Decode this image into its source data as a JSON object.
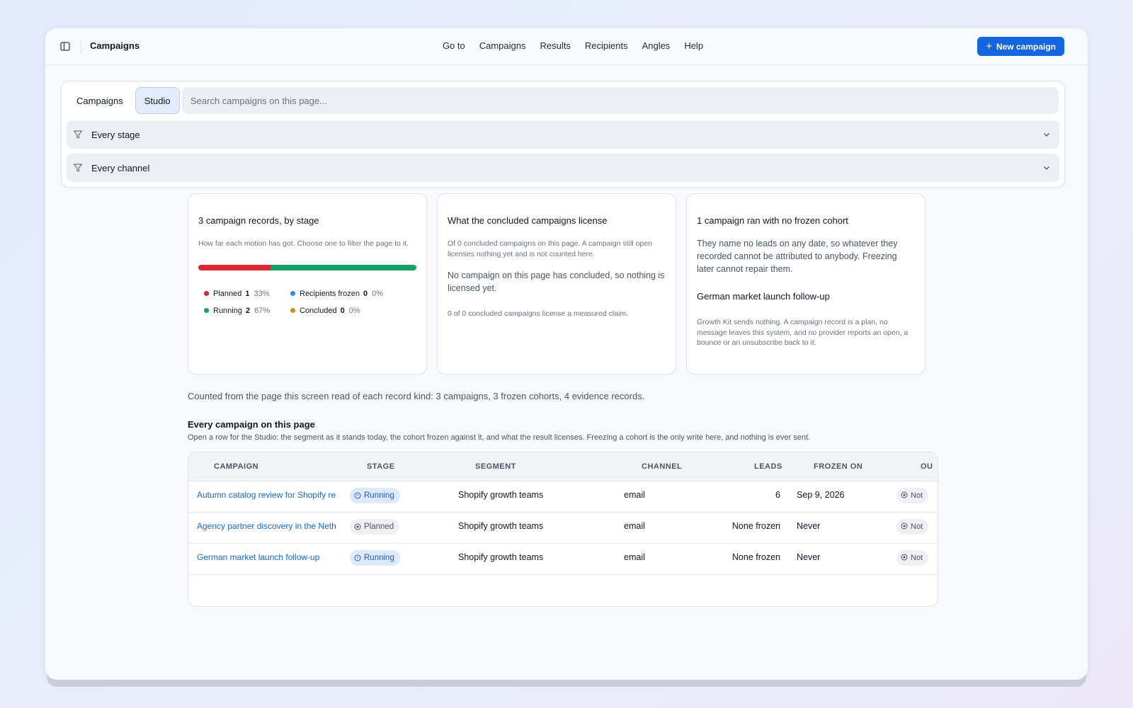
{
  "app": {
    "title": "Campaigns"
  },
  "nav": {
    "items": [
      "Go to",
      "Campaigns",
      "Results",
      "Recipients",
      "Angles",
      "Help"
    ]
  },
  "new_campaign": {
    "label": "New campaign"
  },
  "filters": {
    "tabs": [
      {
        "label": "Campaigns"
      },
      {
        "label": "Studio",
        "active": true
      }
    ],
    "search_placeholder": "Search campaigns on this page...",
    "stage_select": "Every stage",
    "channel_select": "Every channel"
  },
  "cards": {
    "stages": {
      "title": "3 campaign records, by stage",
      "subtitle": "How far each motion has got. Choose one to filter the page to it.",
      "bar": {
        "planned_fraction": 0.33,
        "running_fraction": 0.67
      },
      "legend": [
        {
          "label": "Planned",
          "count": "1",
          "pct": "33%",
          "color": "#dc2634"
        },
        {
          "label": "Recipients frozen",
          "count": "0",
          "pct": "0%",
          "color": "#2f8fd8"
        },
        {
          "label": "Running",
          "count": "2",
          "pct": "67%",
          "color": "#16a061"
        },
        {
          "label": "Concluded",
          "count": "0",
          "pct": "0%",
          "color": "#d98b12"
        }
      ]
    },
    "license": {
      "title": "What the concluded campaigns license",
      "subtitle": "Of 0 concluded campaigns on this page. A campaign still open licenses nothing yet and is not counted here.",
      "body": "No campaign on this page has concluded, so nothing is licensed yet.",
      "footer": "0 of 0 concluded campaigns license a measured claim."
    },
    "cohort": {
      "title": "1 campaign ran with no frozen cohort",
      "body": "They name no leads on any date, so whatever they recorded cannot be attributed to anybody. Freezing later cannot repair them.",
      "campaign": "German market launch follow-up",
      "footer": "Growth Kit sends nothing. A campaign record is a plan, no message leaves this system, and no provider reports an open, a bounce or an unsubscribe back to it."
    }
  },
  "counted_note": "Counted from the page this screen read of each record kind: 3 campaigns, 3 frozen cohorts, 4 evidence records.",
  "list": {
    "title": "Every campaign on this page",
    "subtitle": "Open a row for the Studio: the segment as it stands today, the cohort frozen against it, and what the result licenses. Freezing a cohort is the only write here, and nothing is ever sent."
  },
  "table": {
    "columns": [
      "Campaign",
      "Stage",
      "Segment",
      "Channel",
      "Leads",
      "Frozen on",
      "Ou"
    ],
    "rows": [
      {
        "campaign": "Autumn catalog review for Shopify re",
        "stage": "Running",
        "stage_kind": "running",
        "segment": "Shopify growth teams",
        "channel": "email",
        "leads": "6",
        "frozen_on": "Sep 9, 2026",
        "outcome": "Not"
      },
      {
        "campaign": "Agency partner discovery in the Neth",
        "stage": "Planned",
        "stage_kind": "planned",
        "segment": "Shopify growth teams",
        "channel": "email",
        "leads": "None frozen",
        "frozen_on": "Never",
        "outcome": "Not"
      },
      {
        "campaign": "German market launch follow-up",
        "stage": "Running",
        "stage_kind": "running",
        "segment": "Shopify growth teams",
        "channel": "email",
        "leads": "None frozen",
        "frozen_on": "Never",
        "outcome": "Not"
      }
    ]
  }
}
